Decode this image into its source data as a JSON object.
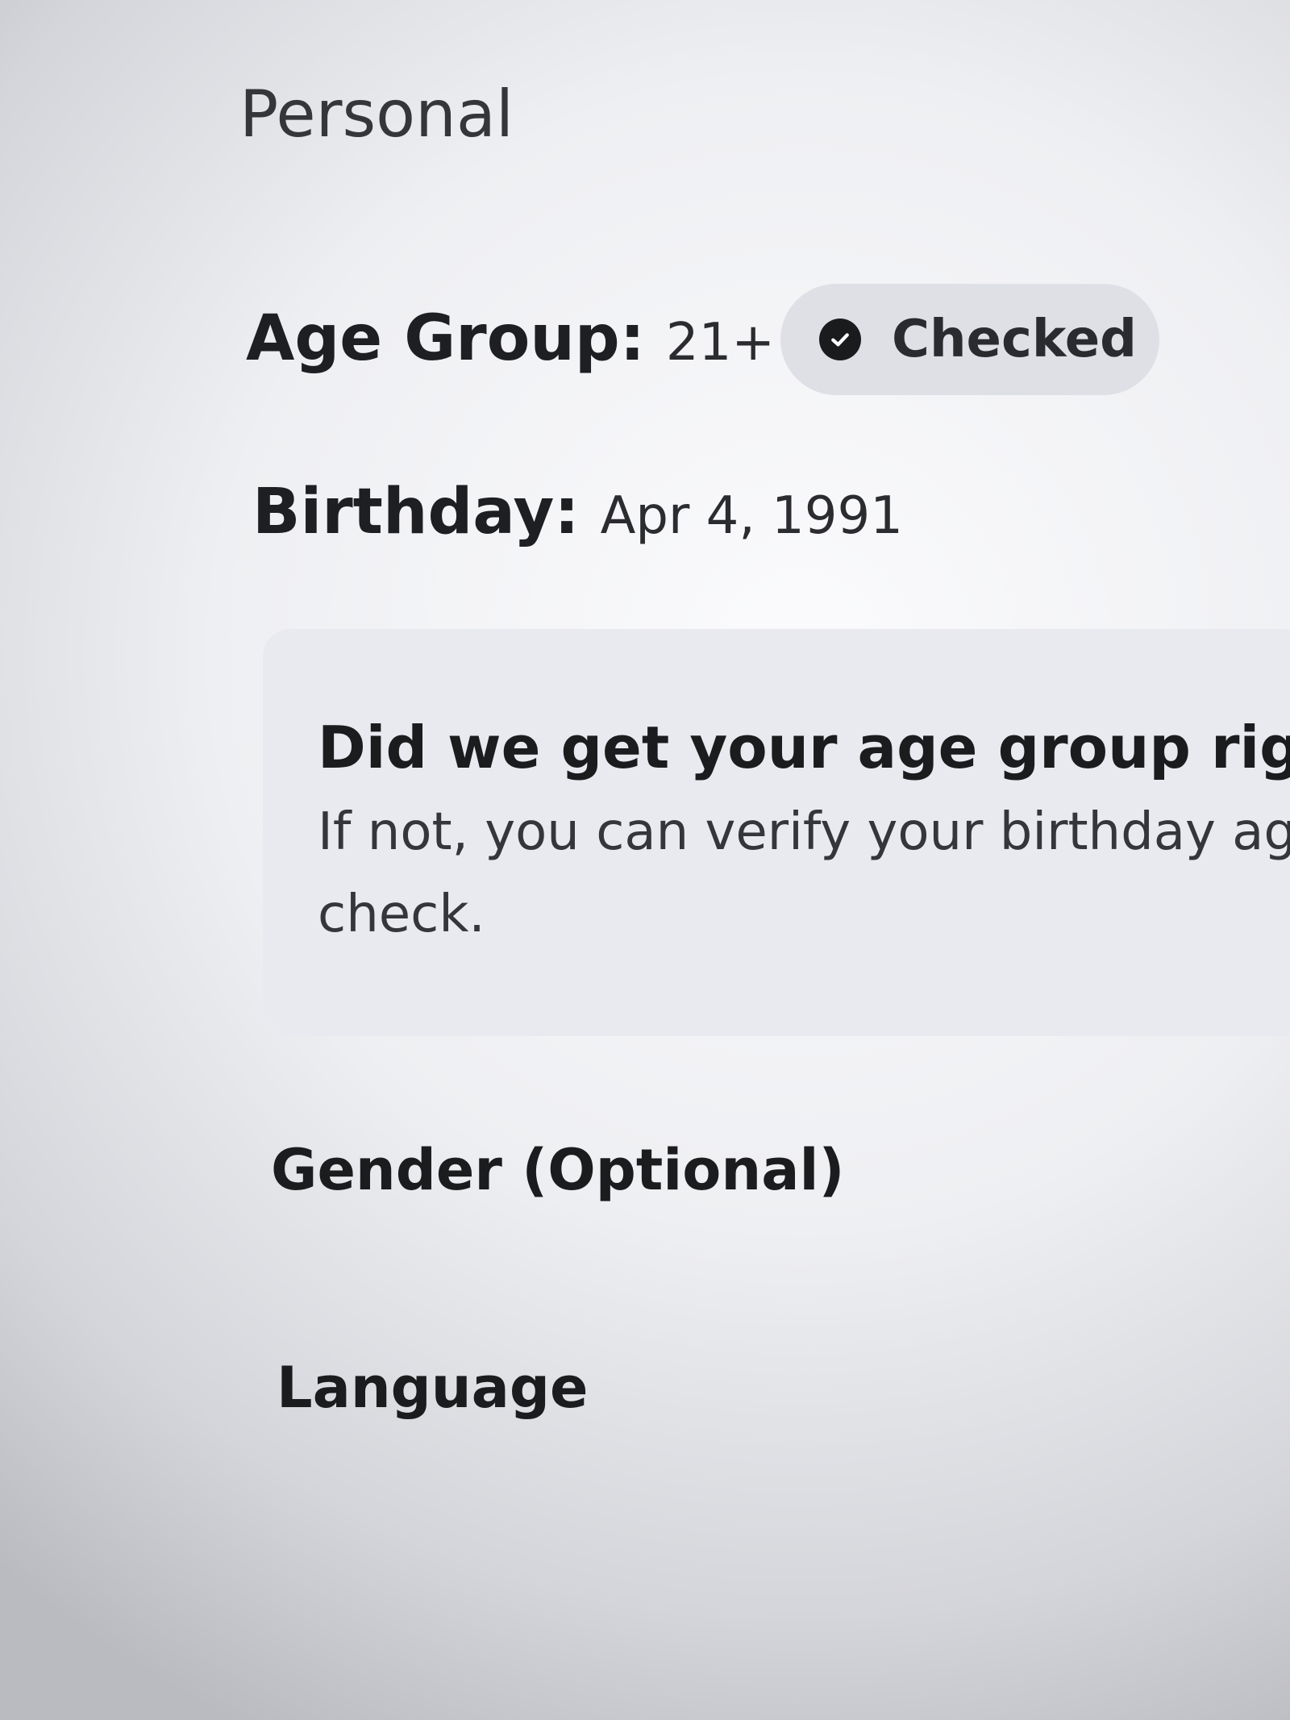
{
  "section": {
    "title": "Personal"
  },
  "age_group": {
    "label": "Age Group:",
    "value": "21+",
    "status_icon": "check-circle-icon",
    "status_label": "Checked"
  },
  "birthday": {
    "label": "Birthday:",
    "value": "Apr 4, 1991"
  },
  "notice": {
    "title": "Did we get your age group rig",
    "body": "If not, you can verify your birthday age check."
  },
  "gender": {
    "label": "Gender (Optional)"
  },
  "language": {
    "label": "Language"
  }
}
